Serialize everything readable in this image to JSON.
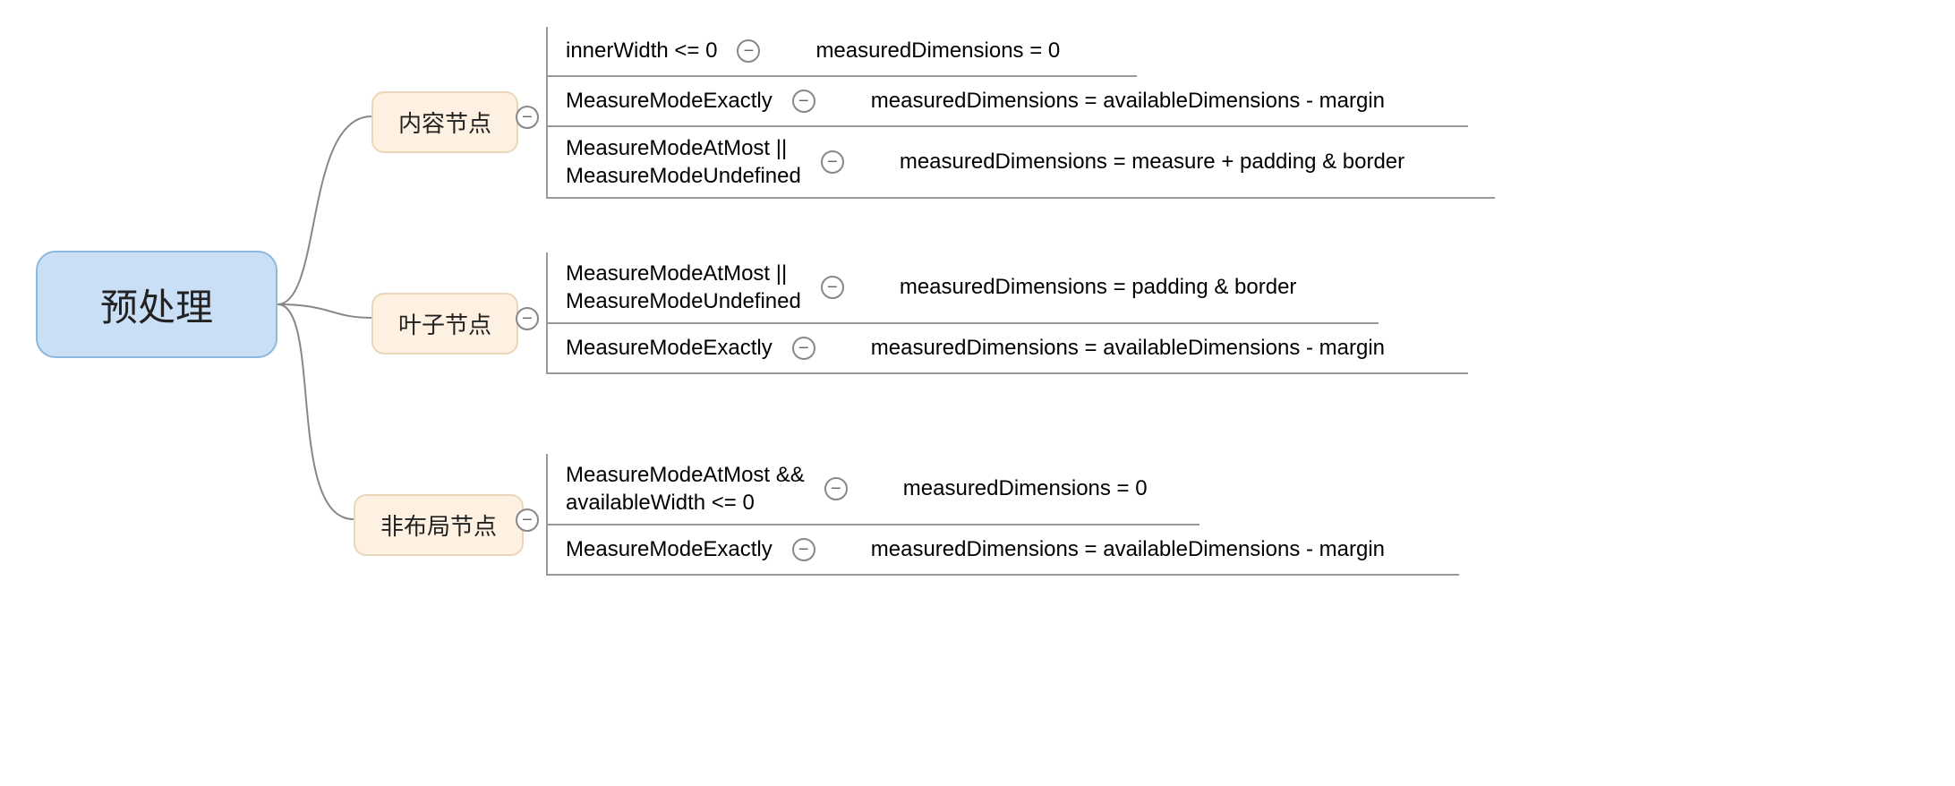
{
  "root": {
    "label": "预处理"
  },
  "branches": [
    {
      "label": "内容节点",
      "rows": [
        {
          "cond": "innerWidth <= 0",
          "result": "measuredDimensions = 0"
        },
        {
          "cond": "MeasureModeExactly",
          "result": "measuredDimensions = availableDimensions - margin"
        },
        {
          "cond": "MeasureModeAtMost ||\nMeasureModeUndefined",
          "result": "measuredDimensions = measure + padding & border"
        }
      ]
    },
    {
      "label": "叶子节点",
      "rows": [
        {
          "cond": "MeasureModeAtMost ||\nMeasureModeUndefined",
          "result": "measuredDimensions = padding & border"
        },
        {
          "cond": "MeasureModeExactly",
          "result": "measuredDimensions = availableDimensions - margin"
        }
      ]
    },
    {
      "label": "非布局节点",
      "rows": [
        {
          "cond": "MeasureModeAtMost &&\navailableWidth <= 0",
          "result": "measuredDimensions = 0"
        },
        {
          "cond": "MeasureModeExactly",
          "result": "measuredDimensions = availableDimensions - margin"
        }
      ]
    }
  ]
}
